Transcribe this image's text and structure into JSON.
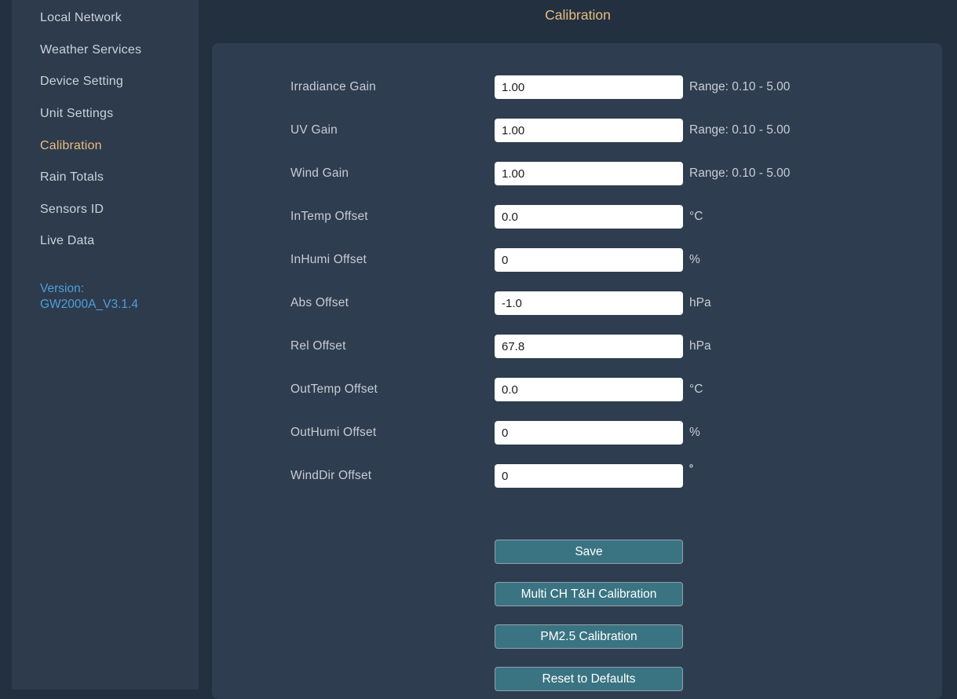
{
  "page_title": "Calibration",
  "sidebar": {
    "items": [
      {
        "label": "Local Network",
        "active": false
      },
      {
        "label": "Weather Services",
        "active": false
      },
      {
        "label": "Device Setting",
        "active": false
      },
      {
        "label": "Unit Settings",
        "active": false
      },
      {
        "label": "Calibration",
        "active": true
      },
      {
        "label": "Rain Totals",
        "active": false
      },
      {
        "label": "Sensors ID",
        "active": false
      },
      {
        "label": "Live Data",
        "active": false
      }
    ],
    "version_label": "Version:",
    "version_value": "GW2000A_V3.1.4"
  },
  "form": {
    "rows": [
      {
        "label": "Irradiance Gain",
        "value": "1.00",
        "suffix": "Range: 0.10 - 5.00",
        "suffix_superscript": false
      },
      {
        "label": "UV Gain",
        "value": "1.00",
        "suffix": "Range: 0.10 - 5.00",
        "suffix_superscript": false
      },
      {
        "label": "Wind Gain",
        "value": "1.00",
        "suffix": "Range: 0.10 - 5.00",
        "suffix_superscript": false
      },
      {
        "label": "InTemp Offset",
        "value": "0.0",
        "suffix": "°C",
        "suffix_superscript": false
      },
      {
        "label": "InHumi Offset",
        "value": "0",
        "suffix": "%",
        "suffix_superscript": false
      },
      {
        "label": "Abs Offset",
        "value": "-1.0",
        "suffix": "hPa",
        "suffix_superscript": false
      },
      {
        "label": "Rel Offset",
        "value": "67.8",
        "suffix": "hPa",
        "suffix_superscript": false
      },
      {
        "label": "OutTemp Offset",
        "value": "0.0",
        "suffix": "°C",
        "suffix_superscript": false
      },
      {
        "label": "OutHumi Offset",
        "value": "0",
        "suffix": "%",
        "suffix_superscript": false
      },
      {
        "label": "WindDir Offset",
        "value": "0",
        "suffix": "º",
        "suffix_superscript": true
      }
    ],
    "buttons": [
      "Save",
      "Multi CH T&H Calibration",
      "PM2.5 Calibration",
      "Reset to Defaults"
    ]
  },
  "colors": {
    "page_background": "#223040",
    "sidebar_background": "#2d3b4d",
    "panel_background": "#2e3d50",
    "accent_orange": "#e9bc7e",
    "version_blue": "#4f9fd9",
    "button_teal": "#3a7482",
    "button_border": "#93a1ad",
    "text_light": "#ccd2d9"
  }
}
